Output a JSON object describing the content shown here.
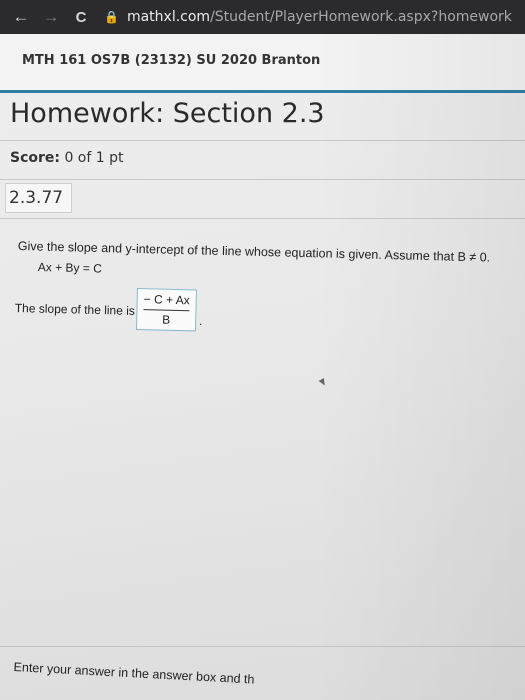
{
  "browser": {
    "back_glyph": "←",
    "forward_glyph": "→",
    "reload_glyph": "C",
    "lock_glyph": "🔒",
    "url_host": "mathxl.com",
    "url_path": "/Student/PlayerHomework.aspx?homework"
  },
  "course": {
    "title": "MTH 161 OS7B (23132) SU 2020 Branton"
  },
  "homework": {
    "title": "Homework: Section 2.3",
    "score_label": "Score:",
    "score_value": "0 of 1 pt",
    "question_number": "2.3.77"
  },
  "question": {
    "instruction": "Give the slope and y-intercept of the line whose equation is given. Assume that B ≠ 0.",
    "equation": "Ax + By = C",
    "slope_label": "The slope of the line is",
    "answer_numerator": "− C + Ax",
    "answer_denominator": "B",
    "period": "."
  },
  "footer": {
    "instruction": "Enter your answer in the answer box and th"
  },
  "colors": {
    "accent": "#2f7fa6",
    "browser_bg": "#2b2b2d"
  }
}
